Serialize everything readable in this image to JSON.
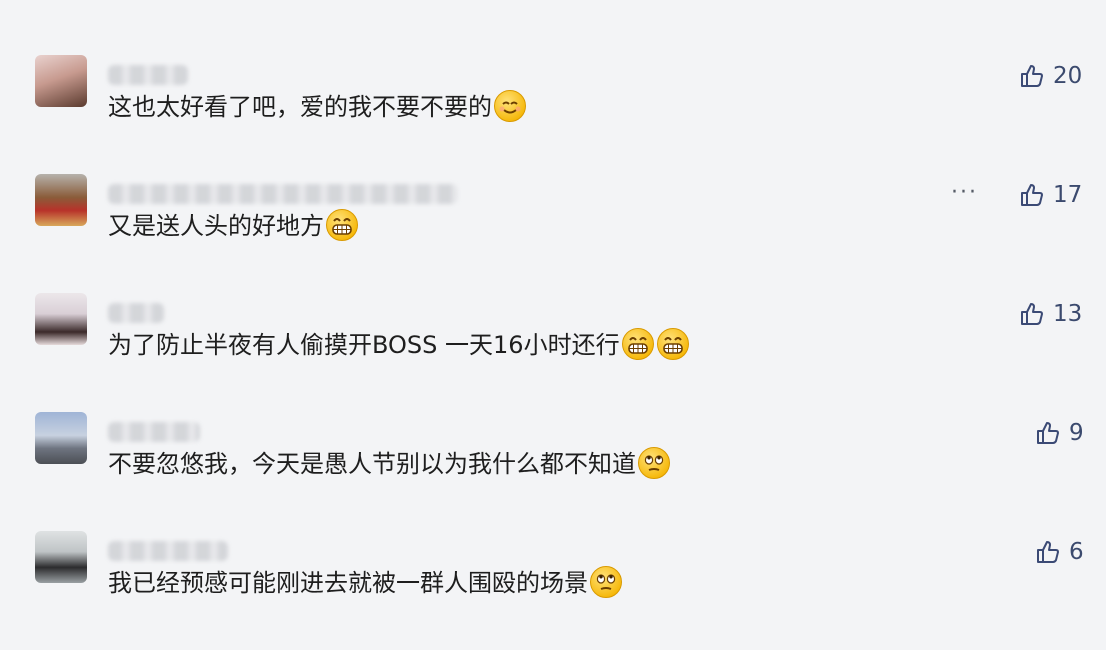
{
  "comments": [
    {
      "text": "这也太好看了吧，爱的我不要不要的",
      "likes": "20",
      "emojis": [
        "smile-emoji"
      ]
    },
    {
      "text": "又是送人头的好地方",
      "likes": "17",
      "emojis": [
        "grin-emoji"
      ],
      "more": "···"
    },
    {
      "text": "为了防止半夜有人偷摸开BOSS 一天16小时还行",
      "likes": "13",
      "emojis": [
        "grin-emoji",
        "grin-emoji"
      ]
    },
    {
      "text": "不要忽悠我，今天是愚人节别以为我什么都不知道",
      "likes": "9",
      "emojis": [
        "eye-roll-emoji"
      ]
    },
    {
      "text": "我已经预感可能刚进去就被一群人围殴的场景",
      "likes": "6",
      "emojis": [
        "eye-roll-emoji"
      ]
    }
  ]
}
